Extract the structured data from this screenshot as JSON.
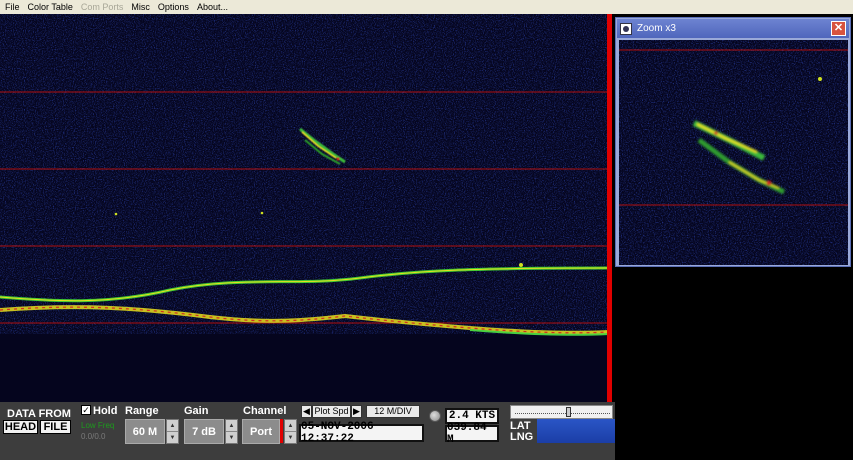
{
  "menu": {
    "items": [
      {
        "label": "File",
        "enabled": true
      },
      {
        "label": "Color Table",
        "enabled": true
      },
      {
        "label": "Com Ports",
        "enabled": false
      },
      {
        "label": "Misc",
        "enabled": true
      },
      {
        "label": "Options",
        "enabled": true
      },
      {
        "label": "About...",
        "enabled": true
      }
    ]
  },
  "zoom_window": {
    "title": "Zoom x3",
    "close_label": "✕"
  },
  "controls": {
    "data_from_label": "DATA FROM",
    "head_button": "HEAD",
    "file_button": "FILE",
    "hold_label": "Hold",
    "hold_checked": true,
    "low_freq_label": "Low Freq",
    "counter_text": "0.0/0.0",
    "range_label": "Range",
    "range_value": "60 M",
    "gain_label": "Gain",
    "gain_value": "7 dB",
    "channel_label": "Channel",
    "channel_value": "Port",
    "plot_speed_label": "Plot Spd",
    "scale_label": "12 M/DIV",
    "datetime": "05-NOV-2006  12:37:22",
    "speed": "2.4 KTS",
    "depth": "039.84 M",
    "lat_label": "LAT",
    "lng_label": "LNG"
  },
  "colors": {
    "sonar_background": "#05051e",
    "grid_line": "#b01010",
    "bottom_return": "#41c832",
    "accent_red": "#e00000",
    "zoom_title": "#5a70c4"
  },
  "icons": {
    "spin_up": "up-arrow-icon",
    "spin_down": "down-arrow-icon",
    "left": "left-arrow-icon",
    "right": "right-arrow-icon",
    "knob": "dial-knob-icon",
    "window": "window-app-icon"
  }
}
